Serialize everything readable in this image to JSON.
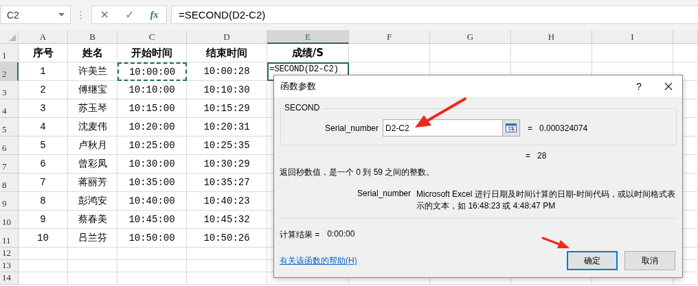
{
  "formula_bar": {
    "name_box": "C2",
    "cancel": "✕",
    "enter": "✓",
    "function": "fx",
    "formula": "=SECOND(D2-C2)"
  },
  "columns": [
    {
      "label": "A",
      "selected": false
    },
    {
      "label": "B",
      "selected": false
    },
    {
      "label": "C",
      "selected": false
    },
    {
      "label": "D",
      "selected": false
    },
    {
      "label": "E",
      "selected": true
    },
    {
      "label": "F",
      "selected": false
    },
    {
      "label": "G",
      "selected": false
    },
    {
      "label": "H",
      "selected": false
    },
    {
      "label": "I",
      "selected": false
    }
  ],
  "rows": [
    {
      "number": "1",
      "selected": false,
      "cells": [
        {
          "text": "序号",
          "marquee": false,
          "active": false
        },
        {
          "text": "姓名",
          "marquee": false,
          "active": false
        },
        {
          "text": "开始时间",
          "marquee": false,
          "active": false
        },
        {
          "text": "结束时间",
          "marquee": false,
          "active": false
        },
        {
          "text": "成绩/S",
          "marquee": false,
          "active": false
        }
      ]
    },
    {
      "number": "2",
      "selected": true,
      "cells": [
        {
          "text": "1",
          "marquee": false,
          "active": false
        },
        {
          "text": "许美兰",
          "marquee": false,
          "active": false
        },
        {
          "text": "10:00:00",
          "marquee": true,
          "active": false
        },
        {
          "text": "10:00:28",
          "marquee": false,
          "active": false
        },
        {
          "text": "=SECOND(D2-C2)",
          "marquee": false,
          "active": true
        }
      ]
    },
    {
      "number": "3",
      "selected": false,
      "cells": [
        {
          "text": "2",
          "marquee": false,
          "active": false
        },
        {
          "text": "傅继宝",
          "marquee": false,
          "active": false
        },
        {
          "text": "10:10:00",
          "marquee": false,
          "active": false
        },
        {
          "text": "10:10:30",
          "marquee": false,
          "active": false
        }
      ]
    },
    {
      "number": "4",
      "selected": false,
      "cells": [
        {
          "text": "3",
          "marquee": false,
          "active": false
        },
        {
          "text": "苏玉琴",
          "marquee": false,
          "active": false
        },
        {
          "text": "10:15:00",
          "marquee": false,
          "active": false
        },
        {
          "text": "10:15:29",
          "marquee": false,
          "active": false
        }
      ]
    },
    {
      "number": "5",
      "selected": false,
      "cells": [
        {
          "text": "4",
          "marquee": false,
          "active": false
        },
        {
          "text": "沈麦伟",
          "marquee": false,
          "active": false
        },
        {
          "text": "10:20:00",
          "marquee": false,
          "active": false
        },
        {
          "text": "10:20:31",
          "marquee": false,
          "active": false
        }
      ]
    },
    {
      "number": "6",
      "selected": false,
      "cells": [
        {
          "text": "5",
          "marquee": false,
          "active": false
        },
        {
          "text": "卢秋月",
          "marquee": false,
          "active": false
        },
        {
          "text": "10:25:00",
          "marquee": false,
          "active": false
        },
        {
          "text": "10:25:35",
          "marquee": false,
          "active": false
        }
      ]
    },
    {
      "number": "7",
      "selected": false,
      "cells": [
        {
          "text": "6",
          "marquee": false,
          "active": false
        },
        {
          "text": "曾彩凤",
          "marquee": false,
          "active": false
        },
        {
          "text": "10:30:00",
          "marquee": false,
          "active": false
        },
        {
          "text": "10:30:29",
          "marquee": false,
          "active": false
        }
      ]
    },
    {
      "number": "8",
      "selected": false,
      "cells": [
        {
          "text": "7",
          "marquee": false,
          "active": false
        },
        {
          "text": "蒋丽芳",
          "marquee": false,
          "active": false
        },
        {
          "text": "10:35:00",
          "marquee": false,
          "active": false
        },
        {
          "text": "10:35:27",
          "marquee": false,
          "active": false
        }
      ]
    },
    {
      "number": "9",
      "selected": false,
      "cells": [
        {
          "text": "8",
          "marquee": false,
          "active": false
        },
        {
          "text": "彭鸿安",
          "marquee": false,
          "active": false
        },
        {
          "text": "10:40:00",
          "marquee": false,
          "active": false
        },
        {
          "text": "10:40:23",
          "marquee": false,
          "active": false
        }
      ]
    },
    {
      "number": "10",
      "selected": false,
      "cells": [
        {
          "text": "9",
          "marquee": false,
          "active": false
        },
        {
          "text": "蔡春美",
          "marquee": false,
          "active": false
        },
        {
          "text": "10:45:00",
          "marquee": false,
          "active": false
        },
        {
          "text": "10:45:32",
          "marquee": false,
          "active": false
        }
      ]
    },
    {
      "number": "11",
      "selected": false,
      "cells": [
        {
          "text": "10",
          "marquee": false,
          "active": false
        },
        {
          "text": "吕兰芬",
          "marquee": false,
          "active": false
        },
        {
          "text": "10:50:00",
          "marquee": false,
          "active": false
        },
        {
          "text": "10:50:26",
          "marquee": false,
          "active": false
        }
      ]
    },
    {
      "number": "12",
      "selected": false
    },
    {
      "number": "13",
      "selected": false
    },
    {
      "number": "14",
      "selected": false
    }
  ],
  "dialog": {
    "title": "函数参数",
    "help": "?",
    "function_name": "SECOND",
    "argument": {
      "label": "Serial_number",
      "value": "D2-C2",
      "equals": "=",
      "result": "0.000324074"
    },
    "result_equals": "=",
    "result": "28",
    "description": "返回秒数值，是一个 0 到 59 之间的整数。",
    "parameter_name": "Serial_number",
    "parameter_description": "Microsoft Excel 进行日期及时间计算的日期-时间代码，或以时间格式表示的文本，如 16:48:23 或 4:48:47 PM",
    "formula_result_label": "计算结果 =",
    "formula_result": "0:00:00",
    "help_link": "有关该函数的帮助(H)",
    "buttons": [
      {
        "label": "确定",
        "default": true
      },
      {
        "label": "取消",
        "default": false
      }
    ]
  }
}
